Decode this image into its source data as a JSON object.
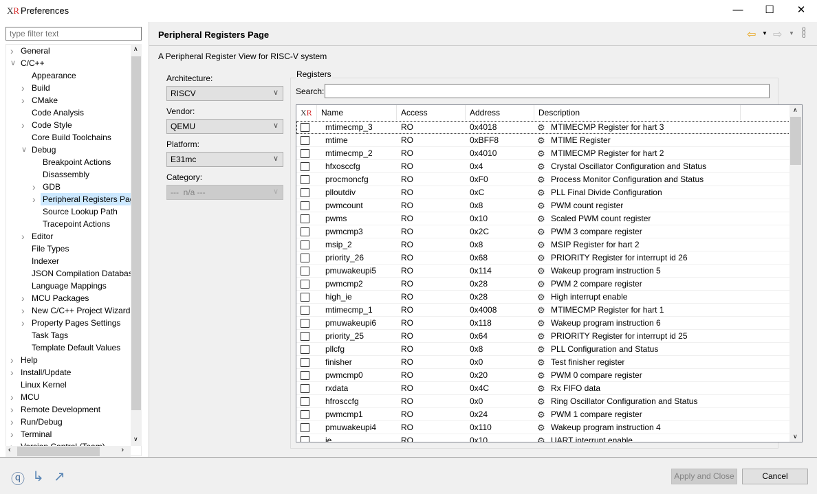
{
  "window": {
    "title": "Preferences",
    "logo": "XR"
  },
  "filter": {
    "placeholder": "type filter text"
  },
  "tree": [
    {
      "label": "General",
      "level": 0,
      "state": "collapsed"
    },
    {
      "label": "C/C++",
      "level": 0,
      "state": "expanded"
    },
    {
      "label": "Appearance",
      "level": 1,
      "state": "leaf"
    },
    {
      "label": "Build",
      "level": 1,
      "state": "collapsed"
    },
    {
      "label": "CMake",
      "level": 1,
      "state": "collapsed"
    },
    {
      "label": "Code Analysis",
      "level": 1,
      "state": "leaf"
    },
    {
      "label": "Code Style",
      "level": 1,
      "state": "collapsed"
    },
    {
      "label": "Core Build Toolchains",
      "level": 1,
      "state": "leaf"
    },
    {
      "label": "Debug",
      "level": 1,
      "state": "expanded"
    },
    {
      "label": "Breakpoint Actions",
      "level": 2,
      "state": "leaf"
    },
    {
      "label": "Disassembly",
      "level": 2,
      "state": "leaf"
    },
    {
      "label": "GDB",
      "level": 2,
      "state": "collapsed"
    },
    {
      "label": "Peripheral Registers Page",
      "level": 2,
      "state": "collapsed",
      "selected": true
    },
    {
      "label": "Source Lookup Path",
      "level": 2,
      "state": "leaf"
    },
    {
      "label": "Tracepoint Actions",
      "level": 2,
      "state": "leaf"
    },
    {
      "label": "Editor",
      "level": 1,
      "state": "collapsed"
    },
    {
      "label": "File Types",
      "level": 1,
      "state": "leaf"
    },
    {
      "label": "Indexer",
      "level": 1,
      "state": "leaf"
    },
    {
      "label": "JSON Compilation Database",
      "level": 1,
      "state": "leaf"
    },
    {
      "label": "Language Mappings",
      "level": 1,
      "state": "leaf"
    },
    {
      "label": "MCU Packages",
      "level": 1,
      "state": "collapsed"
    },
    {
      "label": "New C/C++ Project Wizard",
      "level": 1,
      "state": "collapsed"
    },
    {
      "label": "Property Pages Settings",
      "level": 1,
      "state": "collapsed"
    },
    {
      "label": "Task Tags",
      "level": 1,
      "state": "leaf"
    },
    {
      "label": "Template Default Values",
      "level": 1,
      "state": "leaf"
    },
    {
      "label": "Help",
      "level": 0,
      "state": "collapsed"
    },
    {
      "label": "Install/Update",
      "level": 0,
      "state": "collapsed"
    },
    {
      "label": "Linux Kernel",
      "level": 0,
      "state": "leaf"
    },
    {
      "label": "MCU",
      "level": 0,
      "state": "collapsed"
    },
    {
      "label": "Remote Development",
      "level": 0,
      "state": "collapsed"
    },
    {
      "label": "Run/Debug",
      "level": 0,
      "state": "collapsed"
    },
    {
      "label": "Terminal",
      "level": 0,
      "state": "collapsed"
    },
    {
      "label": "Version Control (Team)",
      "level": 0,
      "state": "collapsed"
    }
  ],
  "page": {
    "title": "Peripheral Registers Page",
    "description": "A Peripheral Register View for RISC-V system"
  },
  "filters": {
    "architecture": {
      "label": "Architecture:",
      "value": "RISCV"
    },
    "vendor": {
      "label": "Vendor:",
      "value": "QEMU"
    },
    "platform": {
      "label": "Platform:",
      "value": "E31mc"
    },
    "category": {
      "label": "Category:",
      "value": "---  n/a ---",
      "disabled": true
    }
  },
  "registers": {
    "group_label": "Registers",
    "search_label": "Search:",
    "search_value": "",
    "header_logo": "XR",
    "columns": [
      "Name",
      "Access",
      "Address",
      "Description"
    ],
    "rows": [
      [
        "mtimecmp_3",
        "RO",
        "0x4018",
        "MTIMECMP Register for hart 3"
      ],
      [
        "mtime",
        "RO",
        "0xBFF8",
        "MTIME Register"
      ],
      [
        "mtimecmp_2",
        "RO",
        "0x4010",
        "MTIMECMP Register for hart 2"
      ],
      [
        "hfxosccfg",
        "RO",
        "0x4",
        "Crystal Oscillator Configuration and Status"
      ],
      [
        "procmoncfg",
        "RO",
        "0xF0",
        "Process Monitor Configuration and Status"
      ],
      [
        "plloutdiv",
        "RO",
        "0xC",
        "PLL Final Divide Configuration"
      ],
      [
        "pwmcount",
        "RO",
        "0x8",
        "PWM count register"
      ],
      [
        "pwms",
        "RO",
        "0x10",
        "Scaled PWM count register"
      ],
      [
        "pwmcmp3",
        "RO",
        "0x2C",
        "PWM 3 compare register"
      ],
      [
        "msip_2",
        "RO",
        "0x8",
        "MSIP Register for hart 2"
      ],
      [
        "priority_26",
        "RO",
        "0x68",
        "PRIORITY Register for interrupt id 26"
      ],
      [
        "pmuwakeupi5",
        "RO",
        "0x114",
        "Wakeup program instruction 5"
      ],
      [
        "pwmcmp2",
        "RO",
        "0x28",
        "PWM 2 compare register"
      ],
      [
        "high_ie",
        "RO",
        "0x28",
        "High interrupt enable"
      ],
      [
        "mtimecmp_1",
        "RO",
        "0x4008",
        "MTIMECMP Register for hart 1"
      ],
      [
        "pmuwakeupi6",
        "RO",
        "0x118",
        "Wakeup program instruction 6"
      ],
      [
        "priority_25",
        "RO",
        "0x64",
        "PRIORITY Register for interrupt id 25"
      ],
      [
        "pllcfg",
        "RO",
        "0x8",
        "PLL Configuration and Status"
      ],
      [
        "finisher",
        "RO",
        "0x0",
        "Test finisher register"
      ],
      [
        "pwmcmp0",
        "RO",
        "0x20",
        "PWM 0 compare register"
      ],
      [
        "rxdata",
        "RO",
        "0x4C",
        "Rx FIFO data"
      ],
      [
        "hfrosccfg",
        "RO",
        "0x0",
        "Ring Oscillator Configuration and Status"
      ],
      [
        "pwmcmp1",
        "RO",
        "0x24",
        "PWM 1 compare register"
      ],
      [
        "pmuwakeupi4",
        "RO",
        "0x110",
        "Wakeup program instruction 4"
      ],
      [
        "ie",
        "RO",
        "0x10",
        "UART interrupt enable"
      ]
    ]
  },
  "buttons": {
    "apply_close": "Apply and Close",
    "cancel": "Cancel"
  },
  "colors": {
    "selection": "#cce8ff",
    "back_arrow": "#e8a317",
    "logo_red": "#d42a2a"
  }
}
